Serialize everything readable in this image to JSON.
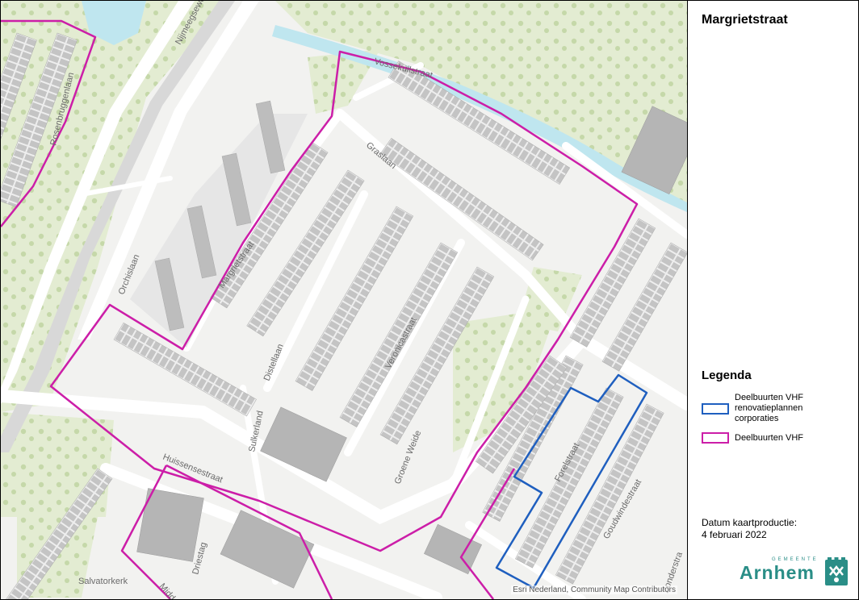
{
  "map_title": "Margrietstraat",
  "legend": {
    "title": "Legenda",
    "items": [
      {
        "label": "Deelbuurten VHF renovatieplannen corporaties",
        "color": "#1f5fbf"
      },
      {
        "label": "Deelbuurten VHF",
        "color": "#cc1ea8"
      }
    ]
  },
  "production": {
    "label": "Datum kaartproductie:",
    "date": "4 februari 2022"
  },
  "logo": {
    "small": "GEMEENTE",
    "main": "Arnhem"
  },
  "attribution": "Esri Nederland, Community Map Contributors",
  "streets": {
    "s1": "Nijmeegseweg",
    "s2": "Vossekuilstraat",
    "s3": "Graslaan",
    "s4": "Orchislaan",
    "s5": "Margrietstraat",
    "s6": "Veronicastraat",
    "s7": "Distellaan",
    "s8": "Sulkerland",
    "s9": "Groene Weide",
    "s10": "Huissensestraat",
    "s11": "Forelstraat",
    "s12": "Goudwindestraat",
    "s13": "Salvatorkerk",
    "s14": "Driestag",
    "s15": "Middeln",
    "s16": "Zonderstra",
    "s17": "Rosenbruggenlaan"
  },
  "colors": {
    "vhf_boundary": "#cc1ea8",
    "renovation_boundary": "#1f5fbf",
    "green": "#e3ecd2",
    "tree": "#c5d8a9",
    "building": "#bdbdbd",
    "water": "#bfe6ef",
    "road": "#ffffff"
  }
}
